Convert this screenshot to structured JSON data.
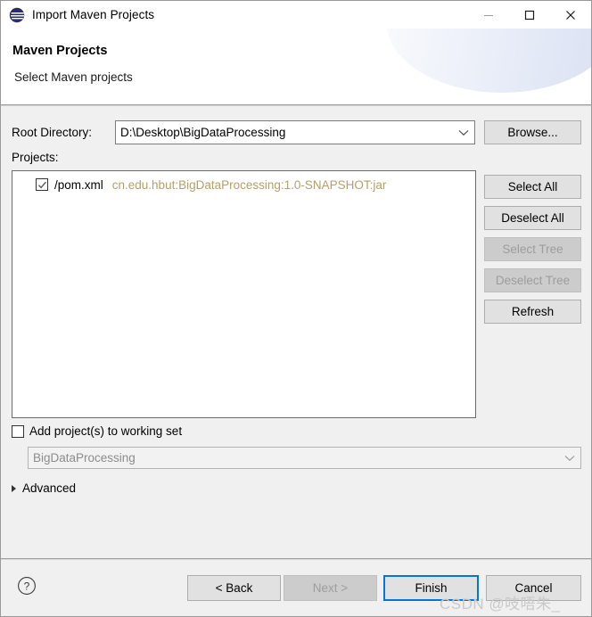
{
  "window": {
    "title": "Import Maven Projects",
    "icon": "eclipse-icon",
    "controls": {
      "minimize": "minimize-icon",
      "maximize": "maximize-icon",
      "close": "close-icon"
    }
  },
  "header": {
    "title": "Maven Projects",
    "subtitle": "Select Maven projects"
  },
  "form": {
    "root_directory_label": "Root Directory:",
    "root_directory_value": "D:\\Desktop\\BigDataProcessing",
    "browse_label": "Browse...",
    "projects_label": "Projects:"
  },
  "tree": {
    "rows": [
      {
        "checked": true,
        "name": "/pom.xml",
        "coordinates": "cn.edu.hbut:BigDataProcessing:1.0-SNAPSHOT:jar"
      }
    ]
  },
  "side_buttons": [
    {
      "label": "Select All",
      "enabled": true
    },
    {
      "label": "Deselect All",
      "enabled": true
    },
    {
      "label": "Select Tree",
      "enabled": false
    },
    {
      "label": "Deselect Tree",
      "enabled": false
    },
    {
      "label": "Refresh",
      "enabled": true
    }
  ],
  "working_set": {
    "checkbox_label": "Add project(s) to working set",
    "checked": false,
    "value": "BigDataProcessing"
  },
  "advanced": {
    "label": "Advanced",
    "expanded": false
  },
  "footer": {
    "help": "?",
    "back_label": "< Back",
    "next_label": "Next >",
    "finish_label": "Finish",
    "cancel_label": "Cancel",
    "watermark": "CSDN @吱唔朱_"
  },
  "colors": {
    "accent": "#0078d7",
    "coordinate_text": "#b5a06a",
    "dialog_bg": "#f0f0f0",
    "disabled_text": "#9d9d9d"
  }
}
